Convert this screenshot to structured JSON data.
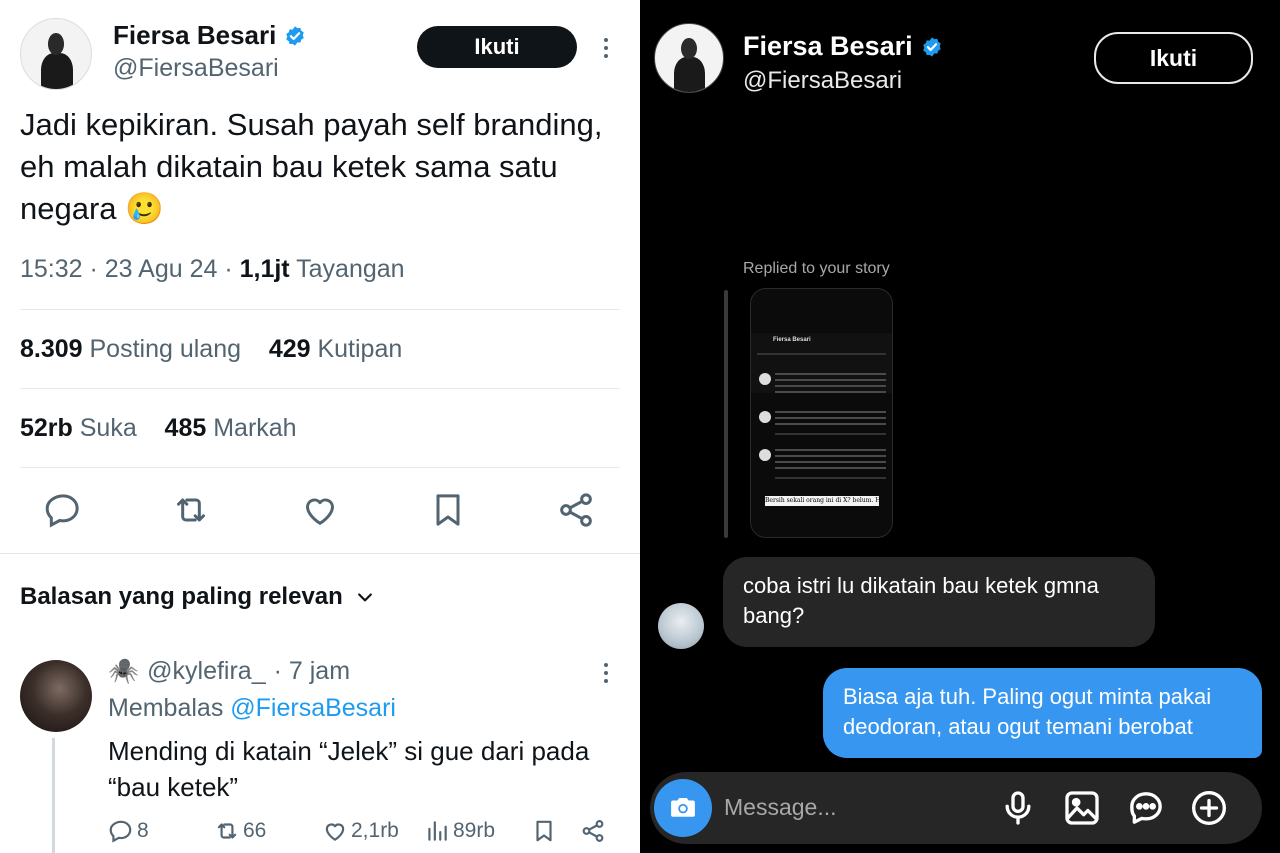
{
  "left": {
    "author": {
      "name": "Fiersa Besari",
      "handle": "@FiersaBesari",
      "follow_label": "Ikuti"
    },
    "tweet": {
      "text": "Jadi kepikiran. Susah payah self branding, eh malah dikatain bau ketek sama satu negara 🥲",
      "time": "15:32 · 23 Agu 24 · ",
      "views_count": "1,1jt",
      "views_label": " Tayangan"
    },
    "stats": {
      "reposts_count": "8.309",
      "reposts_label": " Posting ulang",
      "quotes_count": "429",
      "quotes_label": " Kutipan",
      "likes_count": "52rb",
      "likes_label": " Suka",
      "bookmarks_count": "485",
      "bookmarks_label": " Markah"
    },
    "replies_header": "Balasan yang paling relevan",
    "reply": {
      "emoji": "🕷️",
      "handle": "@kylefira_",
      "time": "· 7 jam",
      "replying_label": "Membalas ",
      "replying_mention": "@FiersaBesari",
      "text": "Mending di katain  “Jelek” si gue dari pada “bau ketek”",
      "comments": "8",
      "reposts": "66",
      "likes": "2,1rb",
      "views": "89rb"
    }
  },
  "right": {
    "author": {
      "name": "Fiersa Besari",
      "handle": "@FiersaBesari",
      "follow_label": "Ikuti"
    },
    "story_label": "Replied to your story",
    "story_caption": "Bersih sekali orang ini di X? belum. Harus",
    "incoming_message": "coba istri lu dikatain bau ketek gmna bang?",
    "outgoing_message": "Biasa aja tuh. Paling ogut minta pakai deodoran, atau ogut temani berobat",
    "composer_placeholder": "Message..."
  },
  "colors": {
    "accent_blue": "#1d9bf0",
    "dm_blue": "#3797f0",
    "dark_bubble": "#262626",
    "muted": "#536471"
  }
}
